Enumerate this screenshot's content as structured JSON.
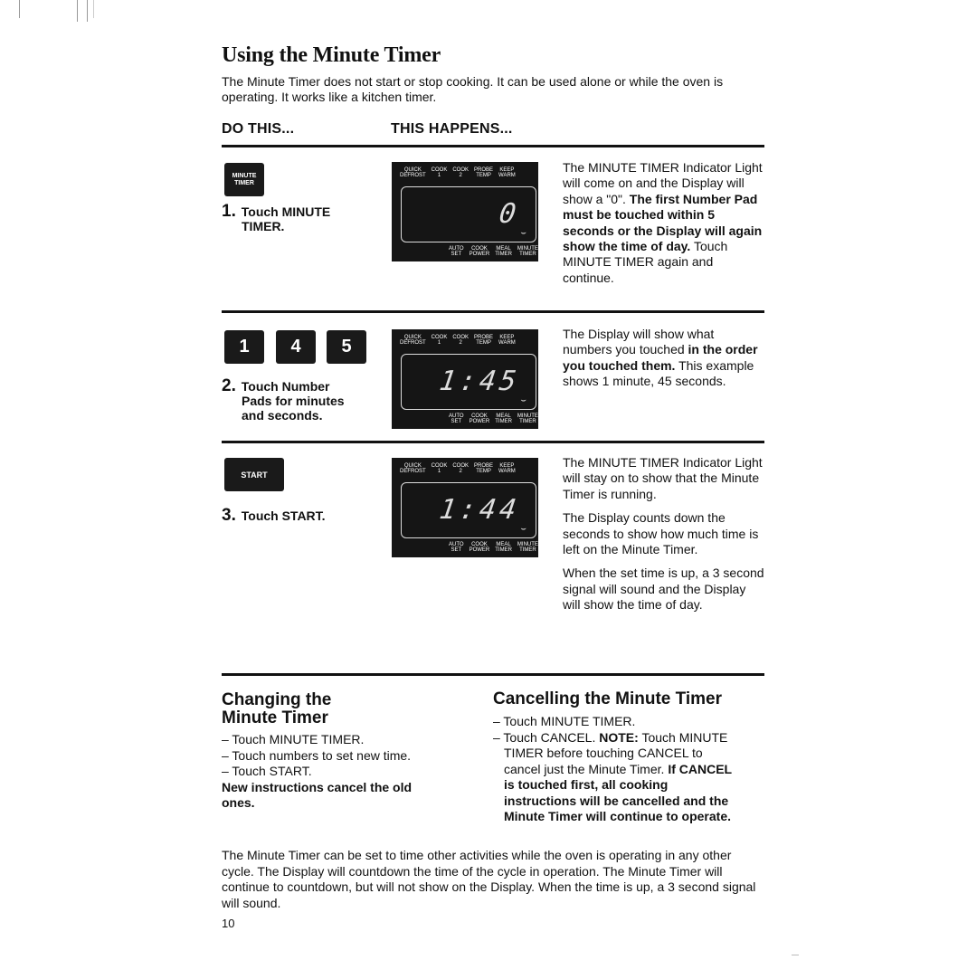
{
  "title": "Using the Minute Timer",
  "intro": "The Minute Timer does not start or stop cooking. It can be used alone or while the oven is operating. It works like a kitchen timer.",
  "columns": {
    "do_this": "DO THIS...",
    "this_happens": "THIS HAPPENS..."
  },
  "display_labels": {
    "top": [
      {
        "line1": "QUICK",
        "line2": "DEFROST"
      },
      {
        "line1": "COOK",
        "line2": "1"
      },
      {
        "line1": "COOK",
        "line2": "2"
      },
      {
        "line1": "PROBE",
        "line2": "TEMP"
      },
      {
        "line1": "KEEP",
        "line2": "WARM"
      }
    ],
    "bottom": [
      {
        "line1": "AUTO",
        "line2": "SET"
      },
      {
        "line1": "COOK",
        "line2": "POWER"
      },
      {
        "line1": "MEAL",
        "line2": "TIMER"
      },
      {
        "line1": "MINUTE",
        "line2": "TIMER"
      }
    ],
    "indicator": "⌣"
  },
  "steps": [
    {
      "pads": [
        {
          "line1": "MINUTE",
          "line2": "TIMER"
        }
      ],
      "number": "1.",
      "instruction_line1": "Touch MINUTE",
      "instruction_line2": "TIMER.",
      "display_value": "0",
      "description": {
        "p1_normal": "The MINUTE TIMER Indicator Light will come on and the Display will show a \"0\". ",
        "p1_bold": "The first Number Pad must be touched within 5 seconds or the Display will again show the time of day.",
        "p1_tail": " Touch MINUTE TIMER again and continue."
      }
    },
    {
      "pads": [
        "1",
        "4",
        "5"
      ],
      "number": "2.",
      "instruction_line1": "Touch Number",
      "instruction_line2": "Pads for minutes",
      "instruction_line3": "and seconds.",
      "display_value": "1:45",
      "description": {
        "p1_normal": "The Display will show what numbers you touched ",
        "p1_bold": "in the order you touched them.",
        "p1_tail": " This example shows 1 minute, 45 seconds."
      }
    },
    {
      "pads": [
        "START"
      ],
      "number": "3.",
      "instruction_line1": "Touch START.",
      "display_value": "1:44",
      "description": {
        "p1": "The MINUTE TIMER Indicator Light will stay on to show that the Minute Timer is running.",
        "p2": "The Display counts down the seconds to show how much time is left on the Minute Timer.",
        "p3": "When the set time is up, a 3 second signal will sound and the Display will show the time of day."
      }
    }
  ],
  "changing": {
    "title_line1": "Changing the",
    "title_line2": "Minute Timer",
    "items": [
      "– Touch MINUTE TIMER.",
      "– Touch numbers to set new time.",
      "– Touch START."
    ],
    "note": "New instructions cancel the old ones."
  },
  "cancelling": {
    "title": "Cancelling the Minute Timer",
    "item1": "– Touch MINUTE TIMER.",
    "item2_normal": "– Touch CANCEL. ",
    "item2_note_label": "NOTE:",
    "item2_note": " Touch MINUTE TIMER before touching CANCEL to cancel just the Minute Timer. ",
    "item2_bold": "If CANCEL is touched first, all cooking instructions will be cancelled and the Minute Timer will continue to operate."
  },
  "footer": "The Minute Timer can be set to time other activities while the oven is operating in any other cycle. The Display will countdown the time of the cycle in operation. The Minute Timer will continue to countdown, but will not show on the Display. When the time is up, a 3 second signal will sound.",
  "page_number": "10"
}
